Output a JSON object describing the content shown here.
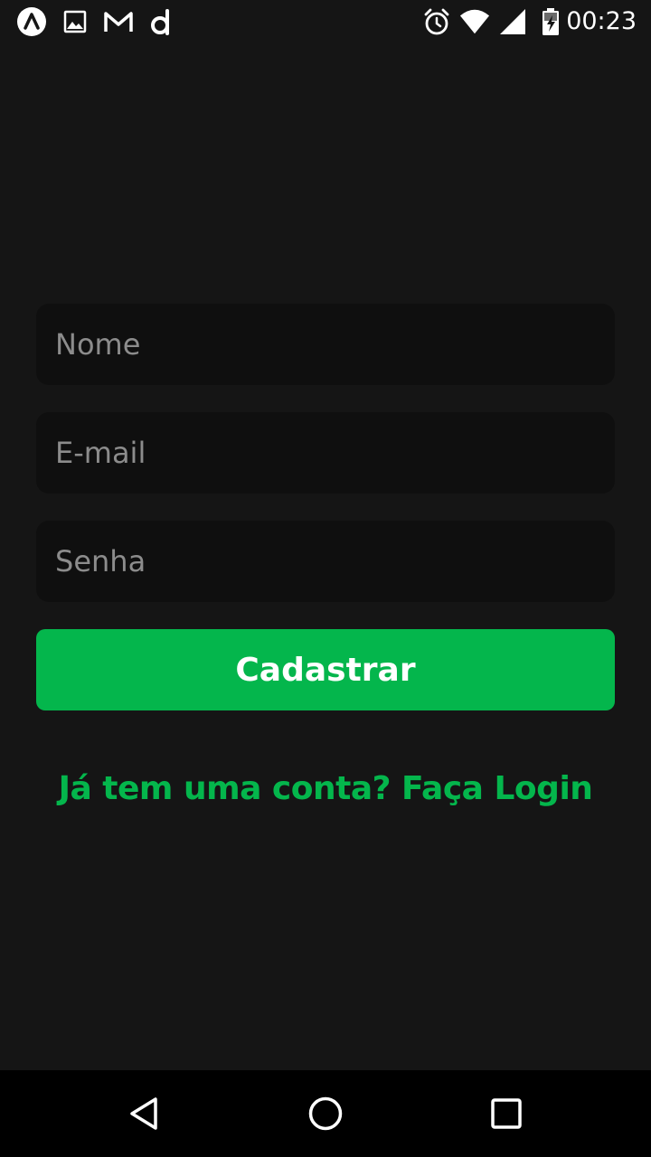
{
  "status_bar": {
    "time": "00:23",
    "left_icons": [
      "app-a-icon",
      "image-icon",
      "gmail-icon",
      "d-app-icon"
    ],
    "right_icons": [
      "alarm-icon",
      "wifi-icon",
      "signal-icon",
      "battery-charging-icon"
    ]
  },
  "form": {
    "name_placeholder": "Nome",
    "email_placeholder": "E-mail",
    "password_placeholder": "Senha",
    "submit_label": "Cadastrar",
    "login_link": "Já tem uma conta? Faça Login"
  },
  "colors": {
    "background": "#151515",
    "field_background": "#0f0f0f",
    "accent_green": "#04b64c",
    "placeholder": "#8c8c8c"
  },
  "nav_bar": {
    "buttons": [
      "back-icon",
      "home-icon",
      "recents-icon"
    ]
  }
}
